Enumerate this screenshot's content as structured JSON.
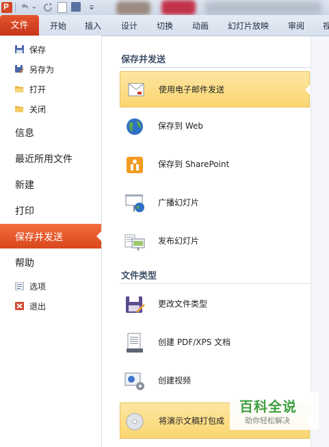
{
  "ribbon": {
    "file_tab": "文件",
    "tabs": [
      "开始",
      "插入",
      "设计",
      "切换",
      "动画",
      "幻灯片放映",
      "审阅",
      "视"
    ]
  },
  "nav": {
    "save": "保存",
    "save_as": "另存为",
    "open": "打开",
    "close": "关闭",
    "info": "信息",
    "recent": "最近所用文件",
    "new": "新建",
    "print": "打印",
    "save_send": "保存并发送",
    "help": "帮助",
    "options": "选项",
    "exit": "退出"
  },
  "main": {
    "section1_title": "保存并发送",
    "items1": [
      {
        "label": "使用电子邮件发送",
        "icon": "email-icon"
      },
      {
        "label": "保存到 Web",
        "icon": "globe-icon"
      },
      {
        "label": "保存到 SharePoint",
        "icon": "sharepoint-icon"
      },
      {
        "label": "广播幻灯片",
        "icon": "broadcast-icon"
      },
      {
        "label": "发布幻灯片",
        "icon": "publish-icon"
      }
    ],
    "section2_title": "文件类型",
    "items2": [
      {
        "label": "更改文件类型",
        "icon": "change-type-icon"
      },
      {
        "label": "创建 PDF/XPS 文档",
        "icon": "pdf-icon"
      },
      {
        "label": "创建视频",
        "icon": "video-icon"
      },
      {
        "label": "将演示文稿打包成",
        "icon": "cd-icon"
      }
    ]
  },
  "watermark": {
    "title": "百科全说",
    "subtitle": "助你轻松解决"
  },
  "colors": {
    "file_tab": "#d24726",
    "selected_nav": "#e85a2c",
    "selected_item": "#fbd670",
    "section_title": "#3d4f66"
  }
}
